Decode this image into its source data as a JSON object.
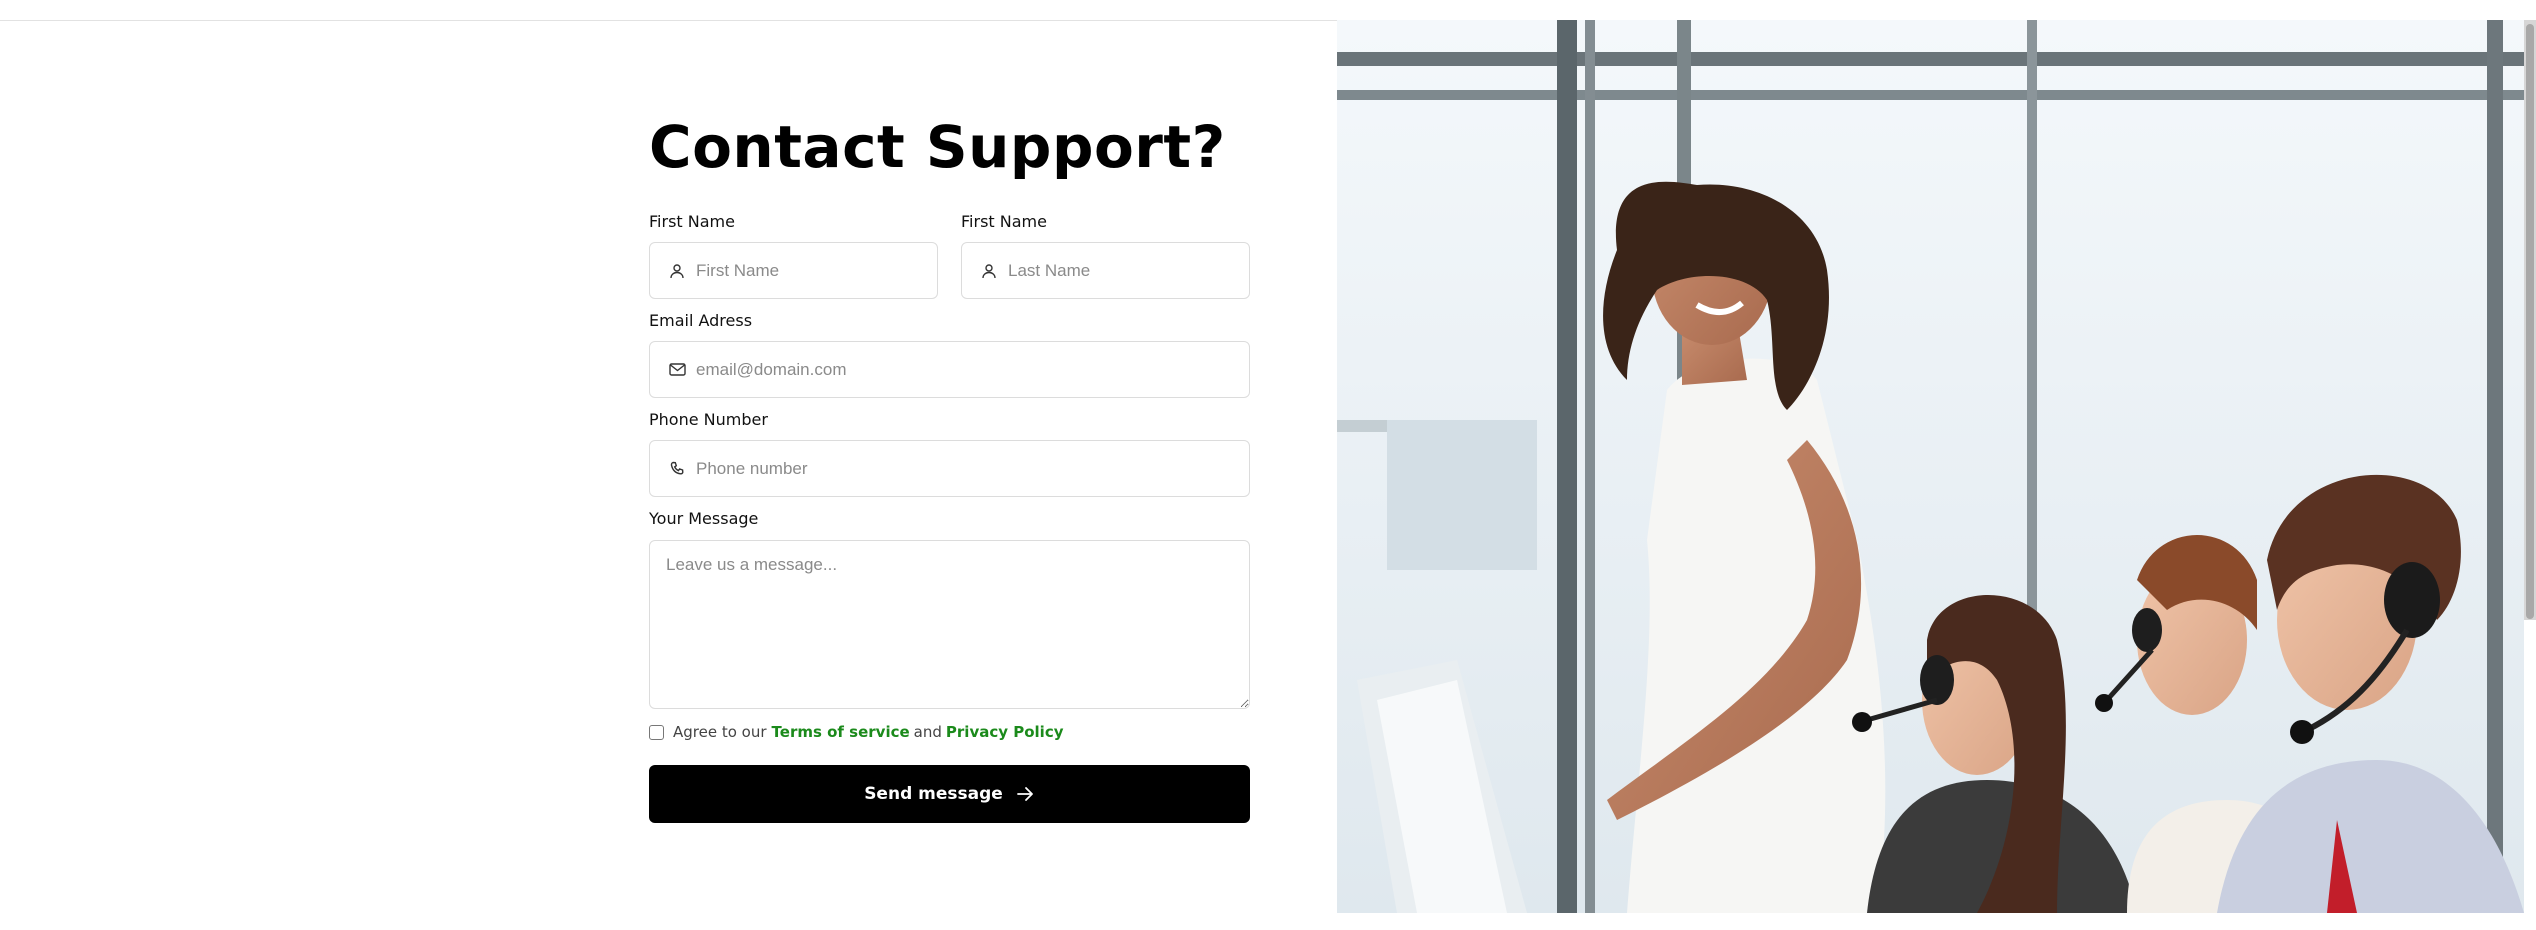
{
  "form": {
    "title": "Contact Support?",
    "first_name": {
      "label": "First Name",
      "placeholder": "First Name",
      "icon": "user-icon"
    },
    "last_name": {
      "label": "First Name",
      "placeholder": "Last Name",
      "icon": "user-icon"
    },
    "email": {
      "label": "Email Adress",
      "placeholder": "email@domain.com",
      "icon": "mail-icon"
    },
    "phone": {
      "label": "Phone Number",
      "placeholder": "Phone number",
      "icon": "phone-icon"
    },
    "message": {
      "label": "Your Message",
      "placeholder": "Leave us a message..."
    },
    "agree": {
      "prefix": "Agree to our",
      "terms": "Terms of service",
      "and": "and",
      "privacy": "Privacy Policy",
      "link_color": "#1b8a1b"
    },
    "submit": {
      "label": "Send message",
      "icon": "arrow-right-icon"
    }
  },
  "image": {
    "subject": "customer-support-team-photo"
  },
  "colors": {
    "button_bg": "#000000",
    "border": "#dcdcdc"
  }
}
